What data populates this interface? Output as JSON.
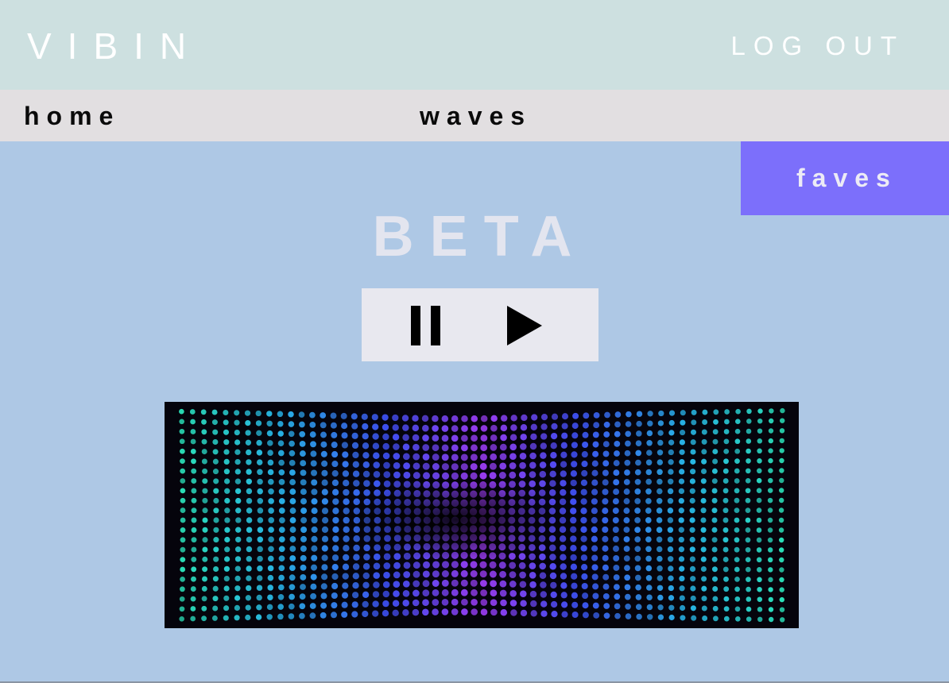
{
  "header": {
    "logo": "VIBIN",
    "logout_label": "LOG OUT"
  },
  "nav": {
    "items": [
      {
        "label": "home"
      },
      {
        "label": "waves"
      }
    ],
    "faves_label": "faves"
  },
  "main": {
    "title": "BETA",
    "controls": {
      "pause_icon": "pause-icon",
      "play_icon": "play-icon"
    },
    "visualizer": {
      "description_icon": "wave-visualizer"
    }
  },
  "colors": {
    "header_bg": "#cde0e0",
    "nav_bg": "#e2dfe1",
    "page_bg": "#aec8e5",
    "faves_bg": "#7c6ffb",
    "title_color": "#e3e5ef",
    "controls_bg": "#e8e8ef"
  }
}
